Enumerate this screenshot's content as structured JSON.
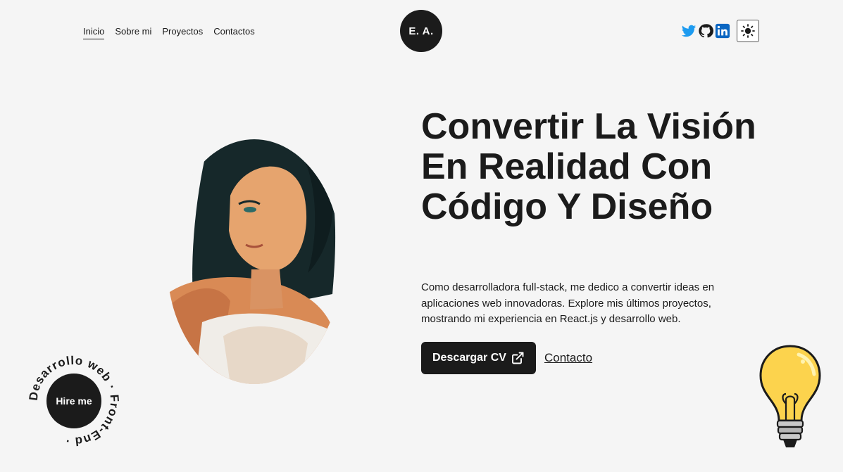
{
  "nav": {
    "items": [
      {
        "label": "Inicio",
        "active": true
      },
      {
        "label": "Sobre mi"
      },
      {
        "label": "Proyectos"
      },
      {
        "label": "Contactos"
      }
    ]
  },
  "logo": {
    "text": "E. A."
  },
  "social": {
    "icons": [
      "twitter-icon",
      "github-icon",
      "linkedin-icon"
    ]
  },
  "theme_toggle": {
    "icon": "sun-icon"
  },
  "hero": {
    "title": "Convertir La Visión En Realidad Con Código Y Diseño",
    "description": "Como desarrolladora full-stack, me dedico a convertir ideas en aplicaciones web innovadoras. Explore mis últimos proyectos, mostrando mi experiencia en React.js y desarrollo web.",
    "cv_button": "Descargar CV",
    "contact_link": "Contacto"
  },
  "hire": {
    "label": "Hire me",
    "ring_text": "Desarrollo web · Front-End ·"
  },
  "colors": {
    "background": "#f5f5f5",
    "dark": "#1b1b1b",
    "twitter": "#1d9bf0",
    "linkedin": "#0a66c2",
    "bulb": "#fcd34d"
  }
}
